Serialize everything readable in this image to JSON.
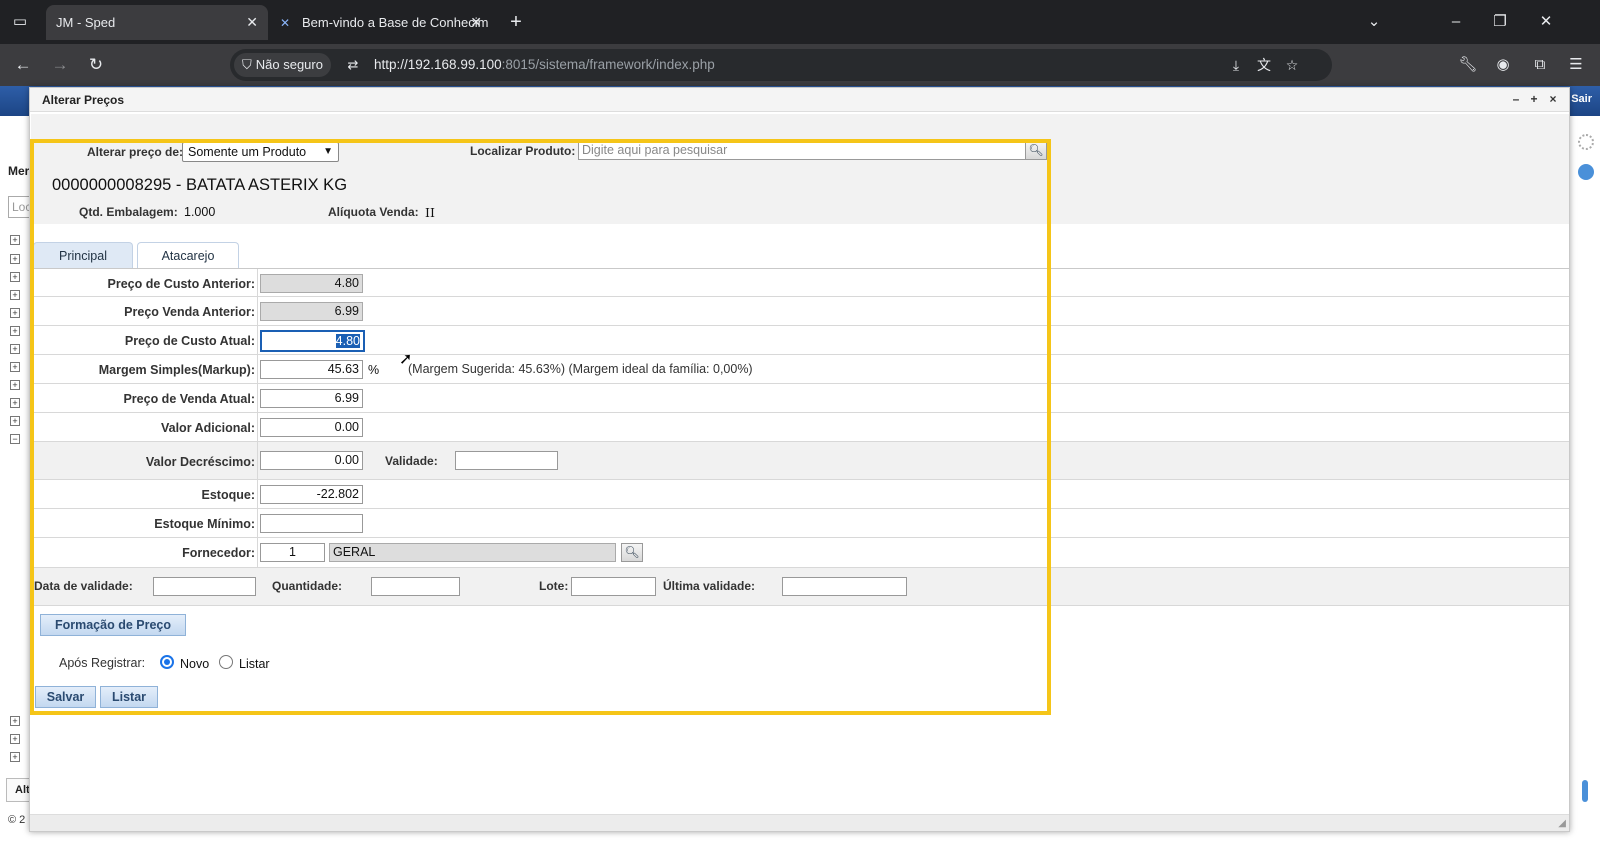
{
  "browser": {
    "tabs": [
      {
        "label": "JM - Sped",
        "active": true
      },
      {
        "label": "Bem-vindo a Base de Conhecim",
        "active": false
      }
    ],
    "security_chip": "Não seguro",
    "url_host": "http://192.168.99.100",
    "url_rest": ":8015/sistema/framework/index.php"
  },
  "app": {
    "logout_label": "Sair",
    "menu_header": "Mer",
    "locate_placeholder": "Loc",
    "bottom_tab": "Alt",
    "copyright": "© 2"
  },
  "modal": {
    "title": "Alterar Preços",
    "alter_price_label": "Alterar preço de:",
    "alter_price_value": "Somente um Produto",
    "find_product_label": "Localizar Produto:",
    "find_product_placeholder": "Digite aqui para pesquisar",
    "product_title": "0000000008295 - BATATA ASTERIX KG",
    "qty_pack_label": "Qtd. Embalagem:",
    "qty_pack_value": "1.000",
    "aliquota_label": "Alíquota Venda:",
    "aliquota_value": "II",
    "tabs": [
      "Principal",
      "Atacarejo"
    ],
    "fields": {
      "custo_anterior": {
        "label": "Preço de Custo Anterior:",
        "value": "4.80"
      },
      "venda_anterior": {
        "label": "Preço Venda Anterior:",
        "value": "6.99"
      },
      "custo_atual": {
        "label": "Preço de Custo Atual:",
        "value": "4.80"
      },
      "margem": {
        "label": "Margem Simples(Markup):",
        "value": "45.63",
        "unit": "%",
        "hint": "(Margem Sugerida: 45.63%) (Margem ideal da família: 0,00%)"
      },
      "venda_atual": {
        "label": "Preço de Venda Atual:",
        "value": "6.99"
      },
      "valor_adicional": {
        "label": "Valor Adicional:",
        "value": "0.00"
      },
      "valor_decrescimo": {
        "label": "Valor Decréscimo:",
        "value": "0.00"
      },
      "validade": {
        "label": "Validade:",
        "value": ""
      },
      "estoque": {
        "label": "Estoque:",
        "value": "-22.802"
      },
      "estoque_minimo": {
        "label": "Estoque Mínimo:",
        "value": ""
      },
      "fornecedor": {
        "label": "Fornecedor:",
        "code": "1",
        "name": "GERAL"
      }
    },
    "validity_row": {
      "data_validade": "Data de validade:",
      "quantidade": "Quantidade:",
      "lote": "Lote:",
      "ultima_validade": "Última validade:"
    },
    "formacao_button": "Formação de Preço",
    "after_register_label": "Após Registrar:",
    "after_register_options": [
      "Novo",
      "Listar"
    ],
    "after_register_selected": "Novo",
    "save_button": "Salvar",
    "list_button": "Listar"
  },
  "colors": {
    "highlight": "#f5c518",
    "accent": "#1a73e8"
  }
}
